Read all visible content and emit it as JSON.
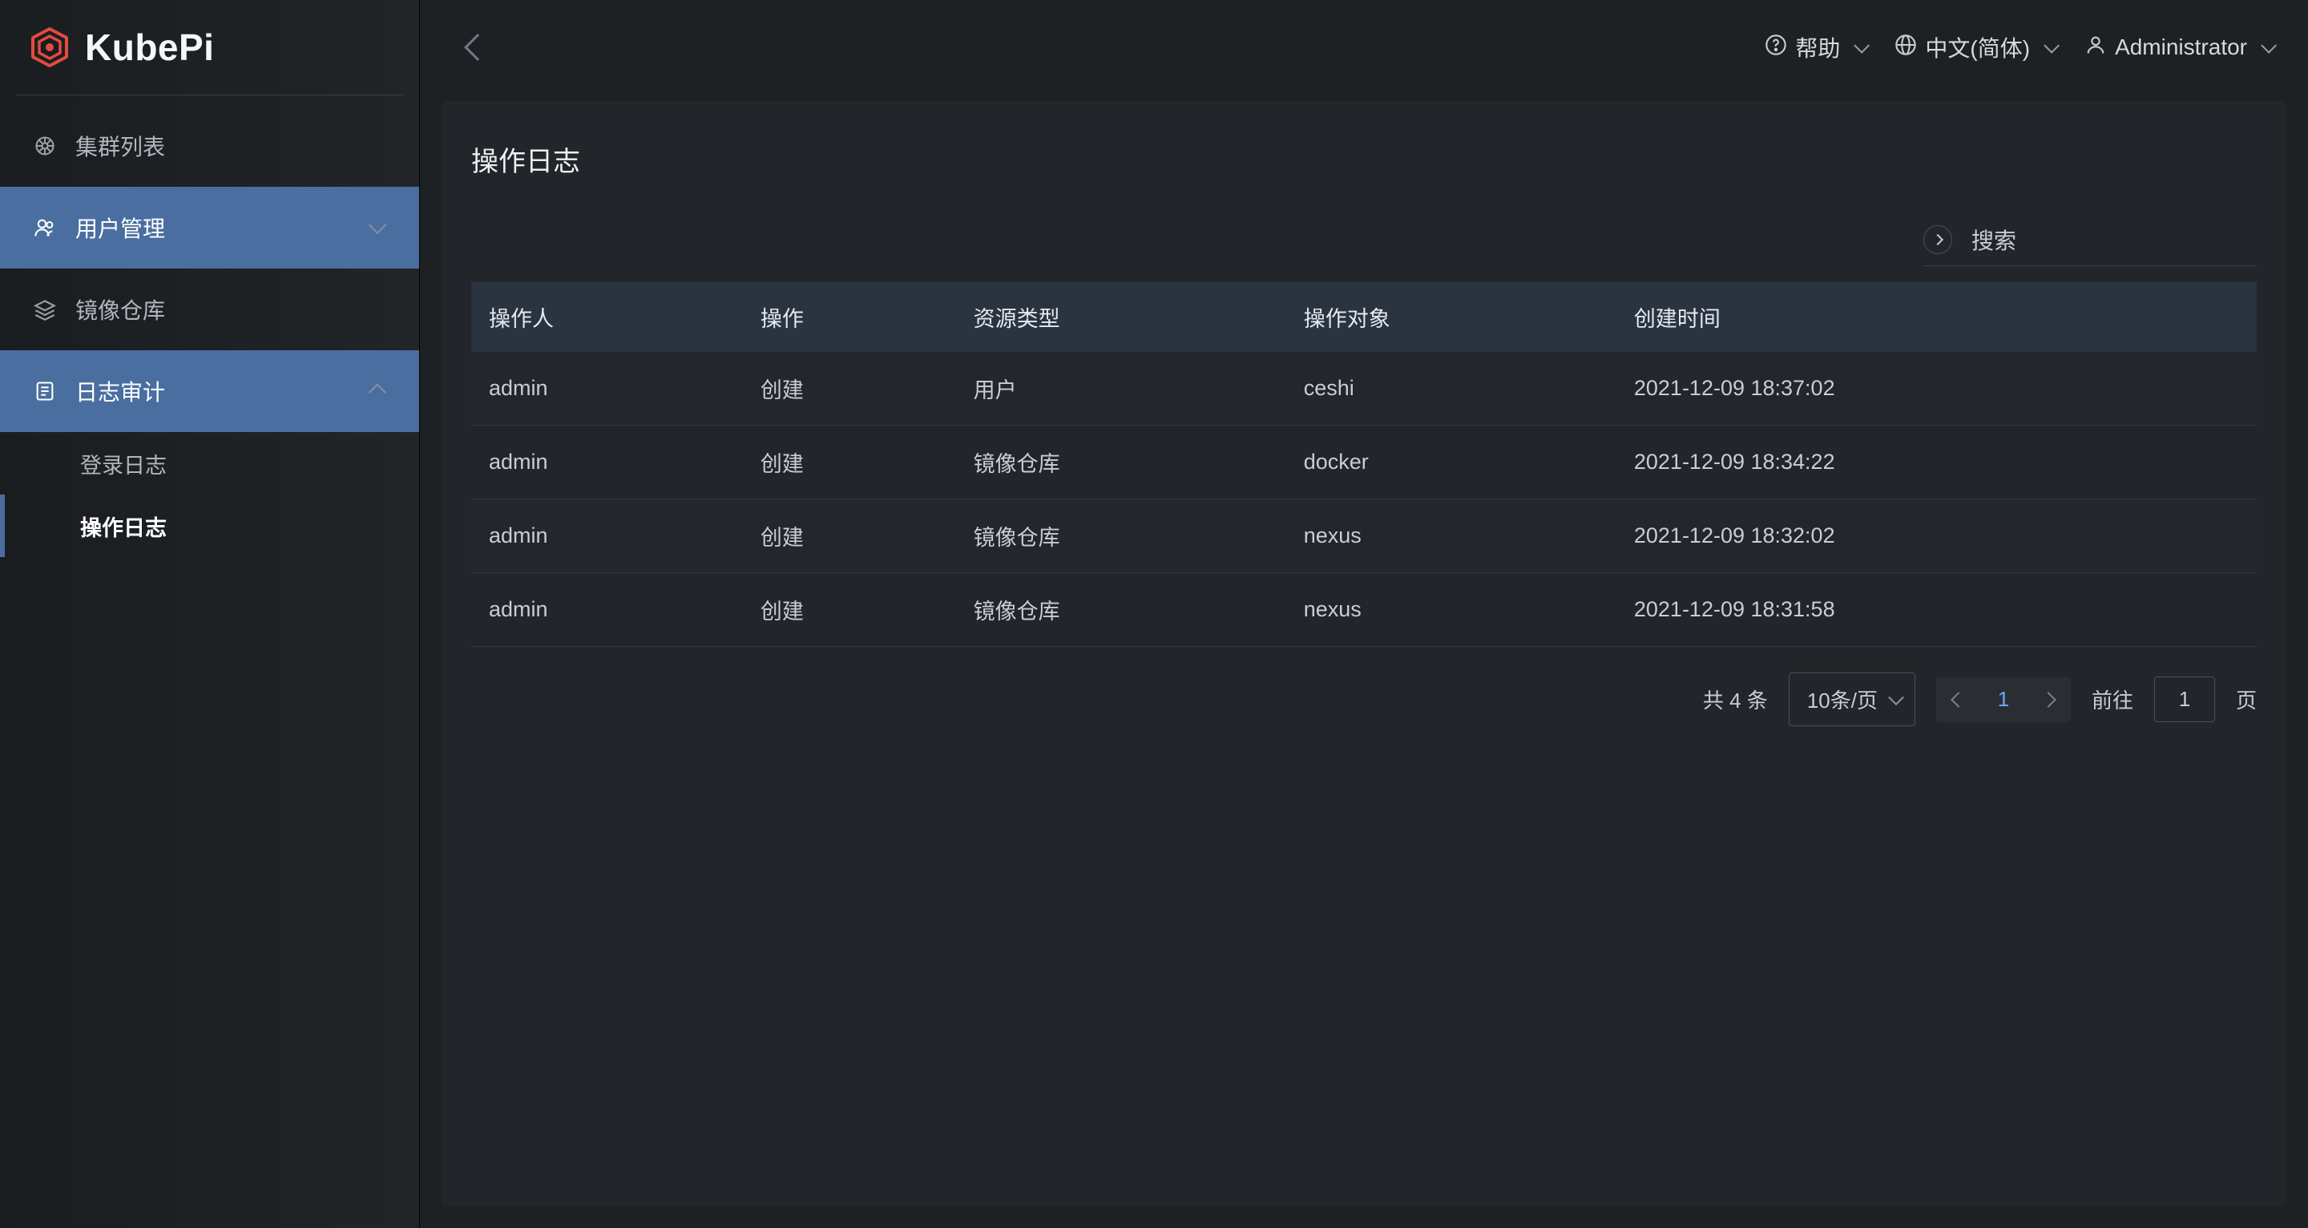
{
  "brand": {
    "name": "KubePi"
  },
  "topbar": {
    "help": "帮助",
    "language": "中文(简体)",
    "user": "Administrator"
  },
  "sidebar": {
    "items": [
      {
        "icon": "wheel-icon",
        "label": "集群列表"
      },
      {
        "icon": "users-icon",
        "label": "用户管理"
      },
      {
        "icon": "layers-icon",
        "label": "镜像仓库"
      },
      {
        "icon": "list-icon",
        "label": "日志审计"
      }
    ],
    "audit_children": [
      {
        "label": "登录日志"
      },
      {
        "label": "操作日志"
      }
    ]
  },
  "page": {
    "title": "操作日志",
    "search_label": "搜索"
  },
  "table": {
    "columns": [
      "操作人",
      "操作",
      "资源类型",
      "操作对象",
      "创建时间"
    ],
    "rows": [
      {
        "c0": "admin",
        "c1": "创建",
        "c2": "用户",
        "c3": "ceshi",
        "c4": "2021-12-09 18:37:02"
      },
      {
        "c0": "admin",
        "c1": "创建",
        "c2": "镜像仓库",
        "c3": "docker",
        "c4": "2021-12-09 18:34:22"
      },
      {
        "c0": "admin",
        "c1": "创建",
        "c2": "镜像仓库",
        "c3": "nexus",
        "c4": "2021-12-09 18:32:02"
      },
      {
        "c0": "admin",
        "c1": "创建",
        "c2": "镜像仓库",
        "c3": "nexus",
        "c4": "2021-12-09 18:31:58"
      }
    ]
  },
  "pagination": {
    "total_text": "共 4 条",
    "page_size_label": "10条/页",
    "current_page": "1",
    "goto_prefix": "前往",
    "goto_value": "1",
    "goto_suffix": "页"
  },
  "colors": {
    "accent": "#4b6ea0",
    "link": "#6aa7ff"
  }
}
